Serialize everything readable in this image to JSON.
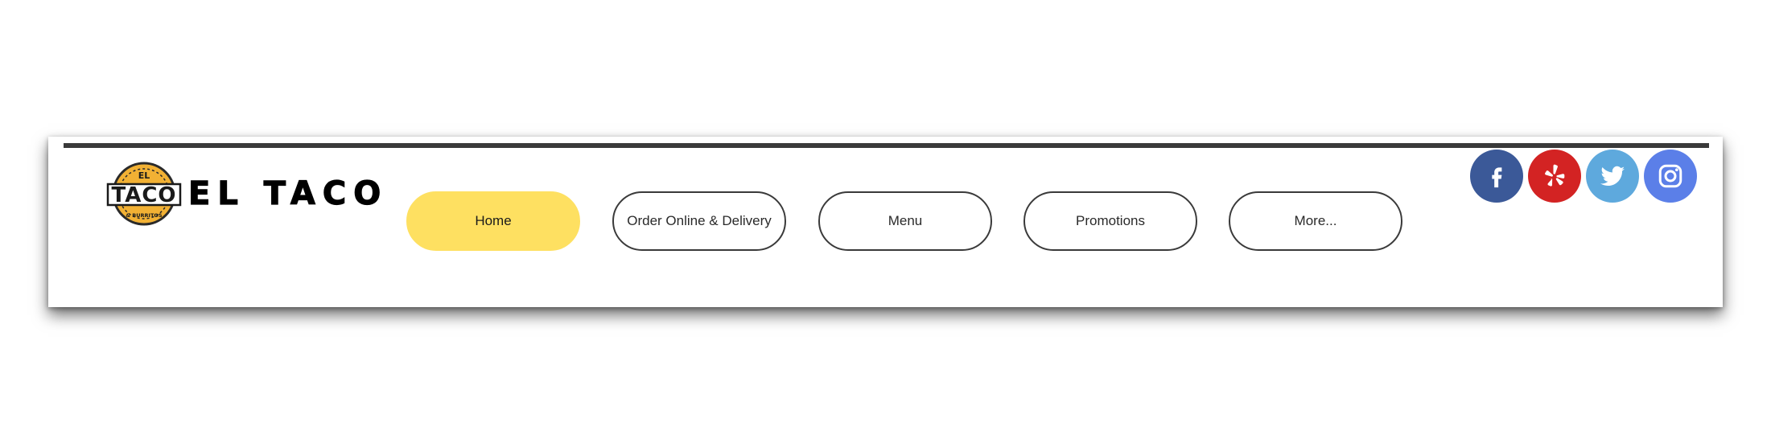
{
  "brand": {
    "name": "EL TACO",
    "badge_top": "EL",
    "badge_main": "TACO",
    "badge_bottom": "& BURRITOS"
  },
  "nav": {
    "items": [
      {
        "label": "Home",
        "active": true
      },
      {
        "label": "Order Online & Delivery",
        "active": false
      },
      {
        "label": "Menu",
        "active": false
      },
      {
        "label": "Promotions",
        "active": false
      },
      {
        "label": "More...",
        "active": false
      }
    ]
  },
  "social": {
    "items": [
      {
        "icon": "facebook-icon",
        "color": "#3b5998"
      },
      {
        "icon": "yelp-icon",
        "color": "#d32323"
      },
      {
        "icon": "twitter-icon",
        "color": "#5ea9dd"
      },
      {
        "icon": "instagram-icon",
        "color": "#5b7fe8"
      }
    ]
  },
  "colors": {
    "active_nav": "#fee061",
    "rule": "#3a3a3a"
  }
}
